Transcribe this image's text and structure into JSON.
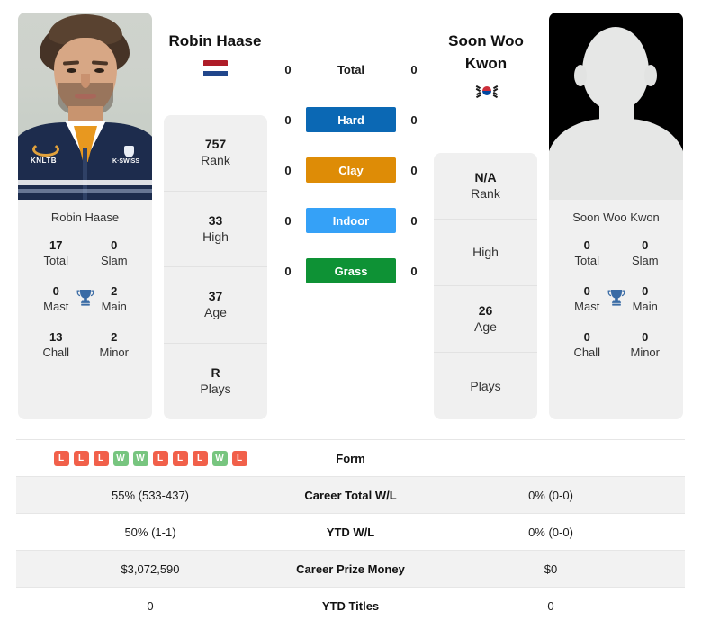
{
  "players": {
    "left": {
      "name": "Robin Haase",
      "flag": "netherlands-flag",
      "photo_caption": "Robin Haase",
      "titles": [
        {
          "value": "17",
          "label": "Total"
        },
        {
          "value": "0",
          "label": "Slam"
        },
        {
          "value": "0",
          "label": "Mast"
        },
        {
          "value": "2",
          "label": "Main"
        },
        {
          "value": "13",
          "label": "Chall"
        },
        {
          "value": "2",
          "label": "Minor"
        }
      ],
      "rank_card": [
        {
          "value": "757",
          "label": "Rank"
        },
        {
          "value": "33",
          "label": "High"
        },
        {
          "value": "37",
          "label": "Age"
        },
        {
          "value": "R",
          "label": "Plays"
        }
      ],
      "surface_counts": {
        "total": "0",
        "hard": "0",
        "clay": "0",
        "indoor": "0",
        "grass": "0"
      }
    },
    "right": {
      "name": "Soon Woo Kwon",
      "flag": "south-korea-flag",
      "photo_caption": "Soon Woo Kwon",
      "titles": [
        {
          "value": "0",
          "label": "Total"
        },
        {
          "value": "0",
          "label": "Slam"
        },
        {
          "value": "0",
          "label": "Mast"
        },
        {
          "value": "0",
          "label": "Main"
        },
        {
          "value": "0",
          "label": "Chall"
        },
        {
          "value": "0",
          "label": "Minor"
        }
      ],
      "rank_card": [
        {
          "value": "N/A",
          "label": "Rank"
        },
        {
          "value": "",
          "label": "High"
        },
        {
          "value": "26",
          "label": "Age"
        },
        {
          "value": "",
          "label": "Plays"
        }
      ],
      "surface_counts": {
        "total": "0",
        "hard": "0",
        "clay": "0",
        "indoor": "0",
        "grass": "0"
      }
    }
  },
  "surfaces": [
    {
      "key": "total",
      "label": "Total",
      "color": "",
      "chip": false
    },
    {
      "key": "hard",
      "label": "Hard",
      "color": "#0b68b4",
      "chip": true
    },
    {
      "key": "clay",
      "label": "Clay",
      "color": "#de8c06",
      "chip": true
    },
    {
      "key": "indoor",
      "label": "Indoor",
      "color": "#35a1f7",
      "chip": true
    },
    {
      "key": "grass",
      "label": "Grass",
      "color": "#0e9235",
      "chip": true
    }
  ],
  "form": {
    "label": "Form",
    "left_results": [
      "L",
      "L",
      "L",
      "W",
      "W",
      "L",
      "L",
      "L",
      "W",
      "L"
    ],
    "right_results": []
  },
  "comparison_rows": [
    {
      "label": "Career Total W/L",
      "left": "55% (533-437)",
      "right": "0% (0-0)"
    },
    {
      "label": "YTD W/L",
      "left": "50% (1-1)",
      "right": "0% (0-0)"
    },
    {
      "label": "Career Prize Money",
      "left": "$3,072,590",
      "right": "$0"
    },
    {
      "label": "YTD Titles",
      "left": "0",
      "right": "0"
    }
  ],
  "colors": {
    "hard": "#0b68b4",
    "clay": "#de8c06",
    "indoor": "#35a1f7",
    "grass": "#0e9235",
    "win": "#77c57f",
    "loss": "#f1604a",
    "trophy": "#3a6ba5",
    "card_bg": "#f0f0f0",
    "row_alt": "#f2f2f2"
  }
}
